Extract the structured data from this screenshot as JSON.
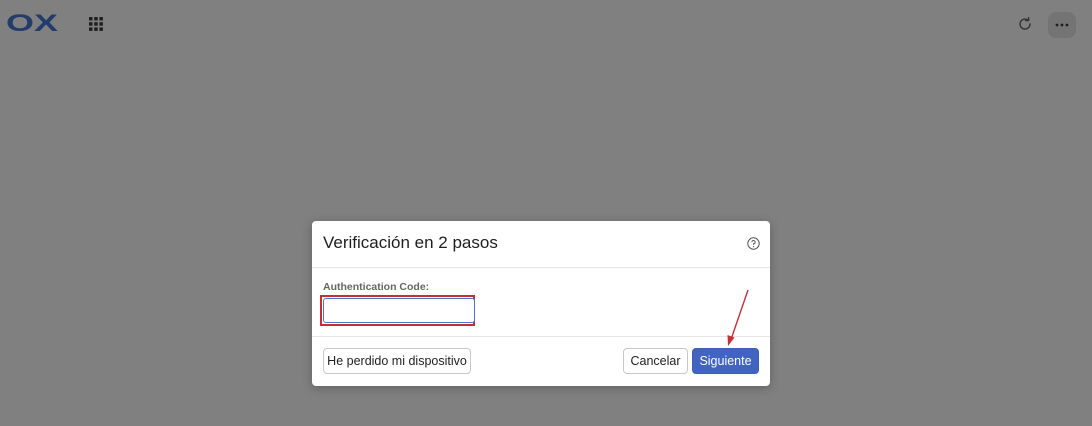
{
  "app": {
    "logo_text": "OX"
  },
  "topbar": {
    "apps_icon": "grid-icon",
    "refresh_icon": "refresh-icon",
    "more_icon": "ellipsis-icon"
  },
  "dialog": {
    "title": "Verificación en 2 pasos",
    "help_icon": "question-circle-icon",
    "field_label": "Authentication Code:",
    "code_value": "",
    "lost_device_label": "He perdido mi dispositivo",
    "cancel_label": "Cancelar",
    "next_label": "Siguiente"
  },
  "colors": {
    "backdrop": "#808080",
    "logo": "#243c6a",
    "primary": "#4163c2",
    "annotation": "#c62f35"
  }
}
